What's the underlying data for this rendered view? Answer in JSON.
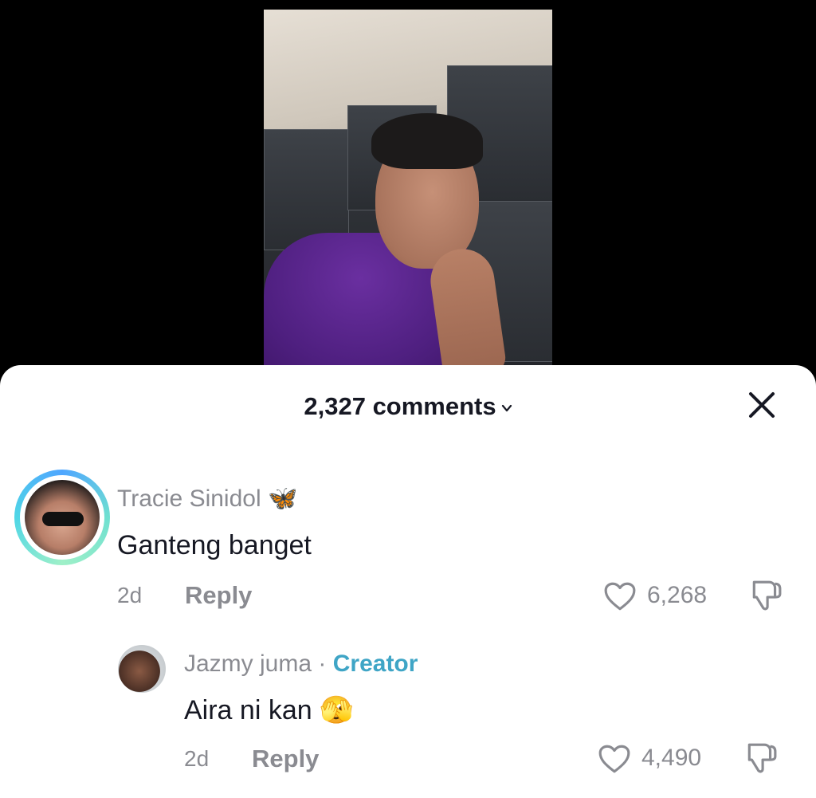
{
  "header": {
    "comment_count_label": "2,327 comments"
  },
  "comments": [
    {
      "username": "Tracie Sinidol",
      "username_emoji": "🦋",
      "text": "Ganteng banget",
      "age": "2d",
      "reply_label": "Reply",
      "like_count": "6,268"
    }
  ],
  "replies": [
    {
      "username": "Jazmy juma",
      "separator": "·",
      "badge": "Creator",
      "text": "Aira ni kan",
      "text_emoji": "🫣",
      "age": "2d",
      "reply_label": "Reply",
      "like_count": "4,490"
    }
  ],
  "colors": {
    "creator_accent": "#3fa5c6",
    "meta_gray": "#8a8b91",
    "text_primary": "#161823"
  },
  "icons": [
    "chevron-down-icon",
    "close-icon",
    "heart-icon",
    "dislike-icon",
    "butterfly-icon",
    "peeking-face-emoji"
  ]
}
